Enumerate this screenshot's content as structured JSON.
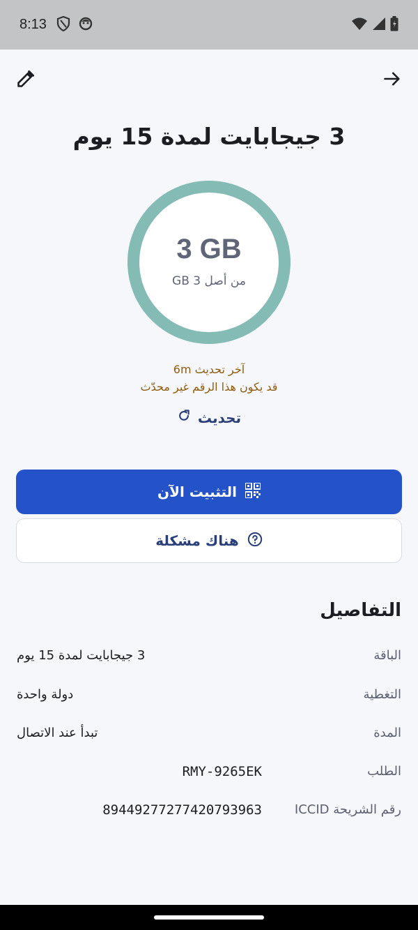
{
  "status_bar": {
    "time": "8:13",
    "icons": [
      "shield-icon",
      "face-icon",
      "wifi-icon",
      "signal-icon",
      "battery-icon"
    ]
  },
  "top_bar": {
    "left_icon": "pencil-icon",
    "right_icon": "arrow-right-icon"
  },
  "plan_title": "3 جيجابايت لمدة 15 يوم",
  "usage": {
    "remaining": "3 GB",
    "of_total": "من أصل 3 GB",
    "ring_fill_fraction": 1.0,
    "ring_color": "#84bbb5"
  },
  "update": {
    "last_updated": "آخر تحديث 6m",
    "warning": "قد يكون هذا الرقم غير محدّث",
    "refresh_label": "تحديث"
  },
  "actions": {
    "install_now": "التثبيت الآن",
    "report_problem": "هناك مشكلة",
    "primary_color": "#2452c9"
  },
  "details": {
    "title": "التفاصيل",
    "rows": [
      {
        "label": "الباقة",
        "value": "3 جيجابايت لمدة 15 يوم"
      },
      {
        "label": "التغطية",
        "value": "دولة واحدة"
      },
      {
        "label": "المدة",
        "value": "تبدأ عند الاتصال"
      },
      {
        "label": "الطلب",
        "value": "RMY-9265EK"
      },
      {
        "label": "رقم الشريحة ICCID",
        "value": "8944927727742079396З"
      }
    ]
  }
}
